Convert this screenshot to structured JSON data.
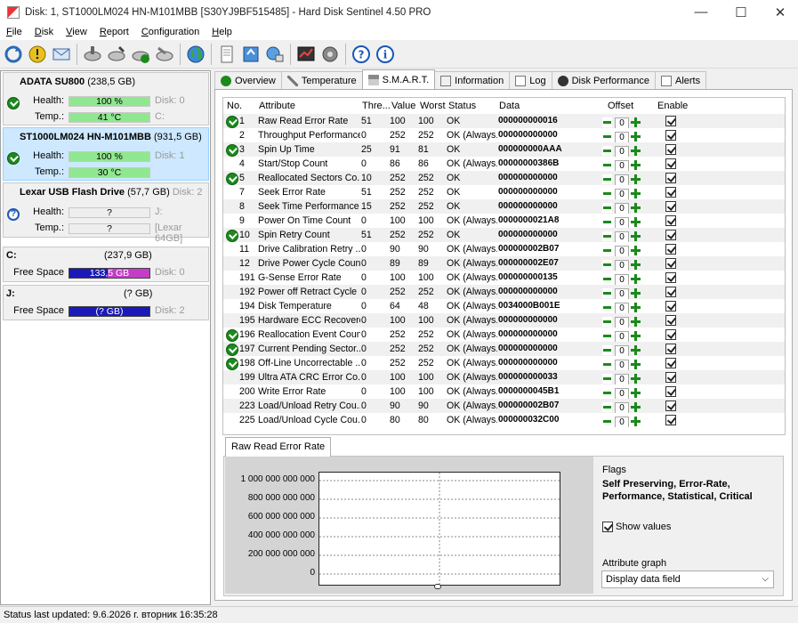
{
  "window": {
    "title": "Disk: 1, ST1000LM024 HN-M101MBB [S30YJ9BF515485]  -  Hard Disk Sentinel 4.50 PRO",
    "minimize": "—",
    "maximize": "☐",
    "close": "✕"
  },
  "menu": [
    {
      "label": "File",
      "u": "F",
      "rest": "ile"
    },
    {
      "label": "Disk",
      "u": "D",
      "rest": "isk"
    },
    {
      "label": "View",
      "u": "V",
      "rest": "iew"
    },
    {
      "label": "Report",
      "u": "R",
      "rest": "eport"
    },
    {
      "label": "Configuration",
      "u": "C",
      "rest": "onfiguration"
    },
    {
      "label": "Help",
      "u": "H",
      "rest": "elp"
    }
  ],
  "disks": [
    {
      "name": "ADATA SU800",
      "size": "(238,5 GB)",
      "disk_no": "Disk: 0",
      "health_label": "Health:",
      "health": "100 %",
      "health_pct": 100,
      "temp_label": "Temp.:",
      "temp": "41 °C",
      "drive": "C:",
      "status": "ok"
    },
    {
      "name": "ST1000LM024 HN-M101MBB",
      "size": "(931,5 GB)",
      "disk_no": "Disk: 1",
      "health_label": "Health:",
      "health": "100 %",
      "health_pct": 100,
      "temp_label": "Temp.:",
      "temp": "30 °C",
      "drive": "",
      "status": "ok"
    },
    {
      "name": "Lexar   USB Flash Drive",
      "size": "(57,7 GB)",
      "disk_no": "Disk: 2",
      "health_label": "Health:",
      "health": "?",
      "temp_label": "Temp.:",
      "temp": "?",
      "drive": "J:",
      "extra": "[Lexar 64GB]",
      "status": "unknown"
    }
  ],
  "volumes": [
    {
      "letter": "C:",
      "size": "(237,9 GB)",
      "free_label": "Free Space",
      "free": "133,5 GB",
      "disk_no": "Disk: 0",
      "free_color": "#c43cc8"
    },
    {
      "letter": "J:",
      "size": "(? GB)",
      "free_label": "Free Space",
      "free": "(? GB)",
      "disk_no": "Disk: 2",
      "free_color": "#1a1ab8"
    }
  ],
  "tabs": [
    "Overview",
    "Temperature",
    "S.M.A.R.T.",
    "Information",
    "Log",
    "Disk Performance",
    "Alerts"
  ],
  "smart": {
    "headers": {
      "no": "No.",
      "attribute": "Attribute",
      "threshold": "Thre...",
      "value": "Value",
      "worst": "Worst",
      "status": "Status",
      "data": "Data",
      "offset": "Offset",
      "enable": "Enable"
    },
    "rows": [
      {
        "no": "1",
        "attr": "Raw Read Error Rate",
        "thr": "51",
        "val": "100",
        "worst": "100",
        "status": "OK",
        "data": "000000000016",
        "offset": "0",
        "icon": true
      },
      {
        "no": "2",
        "attr": "Throughput Performance",
        "thr": "0",
        "val": "252",
        "worst": "252",
        "status": "OK (Always...",
        "data": "000000000000",
        "offset": "0",
        "icon": false
      },
      {
        "no": "3",
        "attr": "Spin Up Time",
        "thr": "25",
        "val": "91",
        "worst": "81",
        "status": "OK",
        "data": "000000000AAA",
        "offset": "0",
        "icon": true
      },
      {
        "no": "4",
        "attr": "Start/Stop Count",
        "thr": "0",
        "val": "86",
        "worst": "86",
        "status": "OK (Always...",
        "data": "00000000386B",
        "offset": "0",
        "icon": false
      },
      {
        "no": "5",
        "attr": "Reallocated Sectors Co...",
        "thr": "10",
        "val": "252",
        "worst": "252",
        "status": "OK",
        "data": "000000000000",
        "offset": "0",
        "icon": true
      },
      {
        "no": "7",
        "attr": "Seek Error Rate",
        "thr": "51",
        "val": "252",
        "worst": "252",
        "status": "OK",
        "data": "000000000000",
        "offset": "0",
        "icon": false
      },
      {
        "no": "8",
        "attr": "Seek Time Performance",
        "thr": "15",
        "val": "252",
        "worst": "252",
        "status": "OK",
        "data": "000000000000",
        "offset": "0",
        "icon": false
      },
      {
        "no": "9",
        "attr": "Power On Time Count",
        "thr": "0",
        "val": "100",
        "worst": "100",
        "status": "OK (Always...",
        "data": "0000000021A8",
        "offset": "0",
        "icon": false
      },
      {
        "no": "10",
        "attr": "Spin Retry Count",
        "thr": "51",
        "val": "252",
        "worst": "252",
        "status": "OK",
        "data": "000000000000",
        "offset": "0",
        "icon": true
      },
      {
        "no": "11",
        "attr": "Drive Calibration Retry ...",
        "thr": "0",
        "val": "90",
        "worst": "90",
        "status": "OK (Always...",
        "data": "000000002B07",
        "offset": "0",
        "icon": false
      },
      {
        "no": "12",
        "attr": "Drive Power Cycle Count",
        "thr": "0",
        "val": "89",
        "worst": "89",
        "status": "OK (Always...",
        "data": "000000002E07",
        "offset": "0",
        "icon": false
      },
      {
        "no": "191",
        "attr": "G-Sense Error Rate",
        "thr": "0",
        "val": "100",
        "worst": "100",
        "status": "OK (Always...",
        "data": "000000000135",
        "offset": "0",
        "icon": false
      },
      {
        "no": "192",
        "attr": "Power off Retract Cycle ...",
        "thr": "0",
        "val": "252",
        "worst": "252",
        "status": "OK (Always...",
        "data": "000000000000",
        "offset": "0",
        "icon": false
      },
      {
        "no": "194",
        "attr": "Disk Temperature",
        "thr": "0",
        "val": "64",
        "worst": "48",
        "status": "OK (Always...",
        "data": "0034000B001E",
        "offset": "0",
        "icon": false
      },
      {
        "no": "195",
        "attr": "Hardware ECC Recovered",
        "thr": "0",
        "val": "100",
        "worst": "100",
        "status": "OK (Always...",
        "data": "000000000000",
        "offset": "0",
        "icon": false
      },
      {
        "no": "196",
        "attr": "Reallocation Event Count",
        "thr": "0",
        "val": "252",
        "worst": "252",
        "status": "OK (Always...",
        "data": "000000000000",
        "offset": "0",
        "icon": true
      },
      {
        "no": "197",
        "attr": "Current Pending Sector...",
        "thr": "0",
        "val": "252",
        "worst": "252",
        "status": "OK (Always...",
        "data": "000000000000",
        "offset": "0",
        "icon": true
      },
      {
        "no": "198",
        "attr": "Off-Line Uncorrectable ...",
        "thr": "0",
        "val": "252",
        "worst": "252",
        "status": "OK (Always...",
        "data": "000000000000",
        "offset": "0",
        "icon": true
      },
      {
        "no": "199",
        "attr": "Ultra ATA CRC Error Co...",
        "thr": "0",
        "val": "100",
        "worst": "100",
        "status": "OK (Always...",
        "data": "000000000033",
        "offset": "0",
        "icon": false
      },
      {
        "no": "200",
        "attr": "Write Error Rate",
        "thr": "0",
        "val": "100",
        "worst": "100",
        "status": "OK (Always...",
        "data": "0000000045B1",
        "offset": "0",
        "icon": false
      },
      {
        "no": "223",
        "attr": "Load/Unload Retry Cou...",
        "thr": "0",
        "val": "90",
        "worst": "90",
        "status": "OK (Always...",
        "data": "000000002B07",
        "offset": "0",
        "icon": false
      },
      {
        "no": "225",
        "attr": "Load/Unload Cycle Cou...",
        "thr": "0",
        "val": "80",
        "worst": "80",
        "status": "OK (Always...",
        "data": "000000032C00",
        "offset": "0",
        "icon": false
      }
    ]
  },
  "graph": {
    "tab": "Raw Read Error Rate",
    "y_labels": [
      "1 000 000 000 000",
      "800 000 000 000",
      "600 000 000 000",
      "400 000 000 000",
      "200 000 000 000",
      "0"
    ],
    "flags_label": "Flags",
    "flags_value": "Self Preserving, Error-Rate, Performance, Statistical, Critical",
    "show_values": "Show values",
    "attribute_graph_label": "Attribute graph",
    "attribute_graph_value": "Display data field"
  },
  "status_bar": "Status last updated: 9.6.2026 г. вторник 16:35:28"
}
